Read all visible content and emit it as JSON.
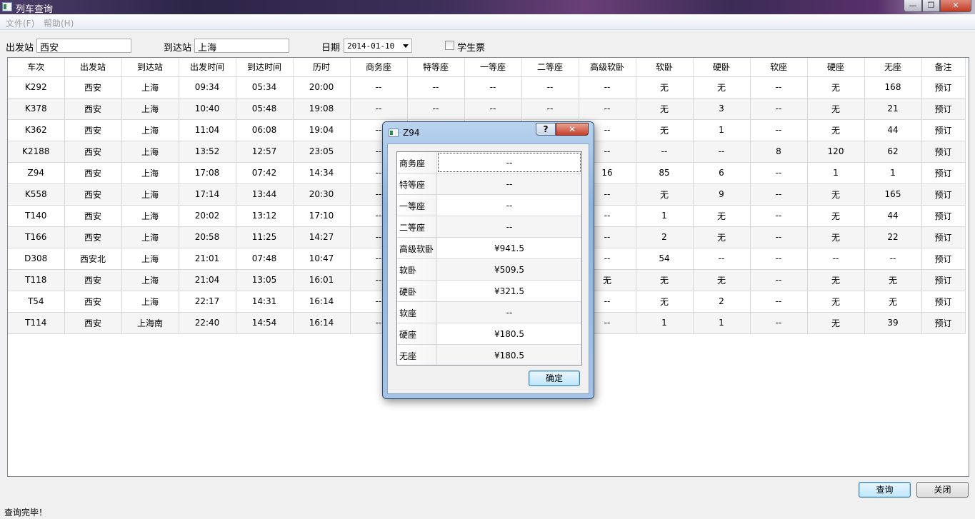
{
  "window": {
    "title": "列车查询",
    "buttons": {
      "minimize": "—",
      "maximize": "❐",
      "close": "✕"
    }
  },
  "menu": {
    "file": "文件(F)",
    "help": "帮助(H)"
  },
  "search": {
    "from_label": "出发站",
    "from_value": "西安",
    "to_label": "到达站",
    "to_value": "上海",
    "date_label": "日期",
    "date_value": "2014-01-10",
    "student_label": "学生票"
  },
  "table": {
    "columns": [
      "车次",
      "出发站",
      "到达站",
      "出发时间",
      "到达时间",
      "历时",
      "商务座",
      "特等座",
      "一等座",
      "二等座",
      "高级软卧",
      "软卧",
      "硬卧",
      "软座",
      "硬座",
      "无座",
      "备注"
    ],
    "rows": [
      [
        "K292",
        "西安",
        "上海",
        "09:34",
        "05:34",
        "20:00",
        "--",
        "--",
        "--",
        "--",
        "--",
        "无",
        "无",
        "--",
        "无",
        "168",
        "预订"
      ],
      [
        "K378",
        "西安",
        "上海",
        "10:40",
        "05:48",
        "19:08",
        "--",
        "--",
        "--",
        "--",
        "--",
        "无",
        "3",
        "--",
        "无",
        "21",
        "预订"
      ],
      [
        "K362",
        "西安",
        "上海",
        "11:04",
        "06:08",
        "19:04",
        "--",
        "--",
        "--",
        "--",
        "--",
        "无",
        "1",
        "--",
        "无",
        "44",
        "预订"
      ],
      [
        "K2188",
        "西安",
        "上海",
        "13:52",
        "12:57",
        "23:05",
        "--",
        "--",
        "--",
        "--",
        "--",
        "--",
        "--",
        "8",
        "120",
        "62",
        "预订"
      ],
      [
        "Z94",
        "西安",
        "上海",
        "17:08",
        "07:42",
        "14:34",
        "--",
        "--",
        "--",
        "--",
        "16",
        "85",
        "6",
        "--",
        "1",
        "1",
        "预订"
      ],
      [
        "K558",
        "西安",
        "上海",
        "17:14",
        "13:44",
        "20:30",
        "--",
        "--",
        "--",
        "--",
        "--",
        "无",
        "9",
        "--",
        "无",
        "165",
        "预订"
      ],
      [
        "T140",
        "西安",
        "上海",
        "20:02",
        "13:12",
        "17:10",
        "--",
        "--",
        "--",
        "--",
        "--",
        "1",
        "无",
        "--",
        "无",
        "44",
        "预订"
      ],
      [
        "T166",
        "西安",
        "上海",
        "20:58",
        "11:25",
        "14:27",
        "--",
        "--",
        "--",
        "--",
        "--",
        "2",
        "无",
        "--",
        "无",
        "22",
        "预订"
      ],
      [
        "D308",
        "西安北",
        "上海",
        "21:01",
        "07:48",
        "10:47",
        "--",
        "--",
        "--",
        "--",
        "--",
        "54",
        "--",
        "--",
        "--",
        "--",
        "预订"
      ],
      [
        "T118",
        "西安",
        "上海",
        "21:04",
        "13:05",
        "16:01",
        "--",
        "--",
        "--",
        "--",
        "无",
        "无",
        "无",
        "--",
        "无",
        "无",
        "预订"
      ],
      [
        "T54",
        "西安",
        "上海",
        "22:17",
        "14:31",
        "16:14",
        "--",
        "--",
        "--",
        "--",
        "--",
        "无",
        "2",
        "--",
        "无",
        "无",
        "预订"
      ],
      [
        "T114",
        "西安",
        "上海南",
        "22:40",
        "14:54",
        "16:14",
        "--",
        "--",
        "--",
        "--",
        "--",
        "1",
        "1",
        "--",
        "无",
        "39",
        "预订"
      ]
    ]
  },
  "buttons": {
    "query": "查询",
    "close": "关闭"
  },
  "status": "查询完毕！",
  "dialog": {
    "title": "Z94",
    "help": "?",
    "close": "✕",
    "fares": [
      {
        "seat": "商务座",
        "price": "--"
      },
      {
        "seat": "特等座",
        "price": "--"
      },
      {
        "seat": "一等座",
        "price": "--"
      },
      {
        "seat": "二等座",
        "price": "--"
      },
      {
        "seat": "高级软卧",
        "price": "¥941.5"
      },
      {
        "seat": "软卧",
        "price": "¥509.5"
      },
      {
        "seat": "硬卧",
        "price": "¥321.5"
      },
      {
        "seat": "软座",
        "price": "--"
      },
      {
        "seat": "硬座",
        "price": "¥180.5"
      },
      {
        "seat": "无座",
        "price": "¥180.5"
      }
    ],
    "ok": "确定"
  }
}
